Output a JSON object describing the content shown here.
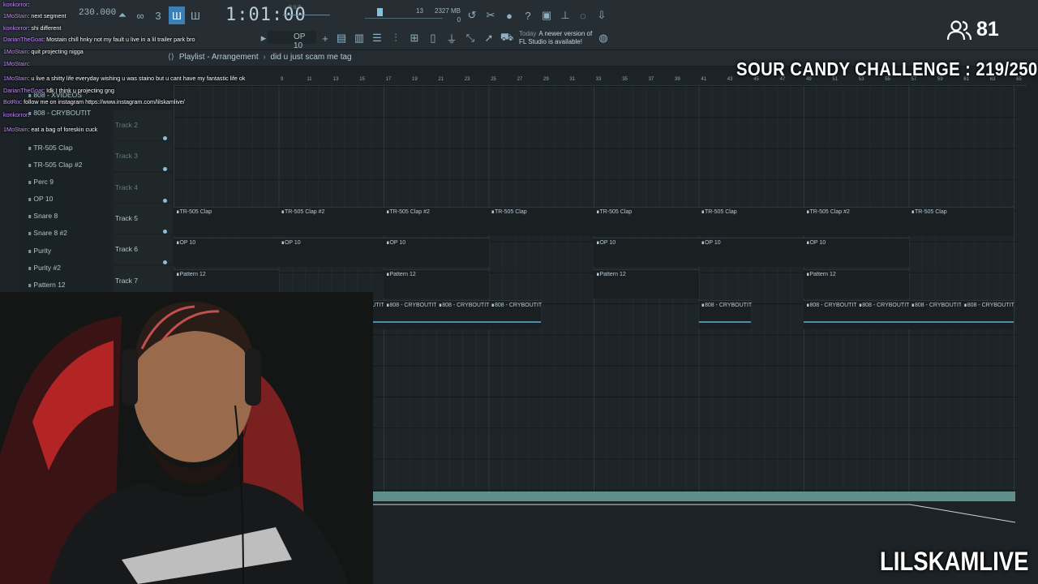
{
  "toolbar": {
    "tempo": "230.000",
    "time": "1:01:00",
    "time_sub": "B:S:T",
    "cpu_count": "13",
    "ram": "2327 MB",
    "ram_sub": "0",
    "pattern": "OP 10",
    "news_today": "Today",
    "news_text_1": "A newer version of",
    "news_text_2": "FL Studio is available!"
  },
  "playlist": {
    "title": "Playlist - Arrangement",
    "crumb": "did u just scam me tag",
    "ruler": [
      "9",
      "11",
      "13",
      "15",
      "17",
      "19",
      "21",
      "23",
      "25",
      "27",
      "29",
      "31",
      "33",
      "35",
      "37",
      "39",
      "41",
      "43",
      "45",
      "47",
      "49",
      "51",
      "53",
      "55",
      "57",
      "59",
      "61",
      "63",
      "65"
    ]
  },
  "browser": {
    "items": [
      "808 - XVIDEOS",
      "808 - CRYBOUTIT",
      "TR-505 Clap",
      "TR-505 Clap #2",
      "Perc 9",
      "OP 10",
      "Snare 8",
      "Snare 8 #2",
      "Purity",
      "Purity #2",
      "Pattern 12"
    ]
  },
  "tracks": [
    {
      "name": "Track 2",
      "dim": true
    },
    {
      "name": "Track 3",
      "dim": true
    },
    {
      "name": "Track 4",
      "dim": true
    },
    {
      "name": "Track 5",
      "dim": false
    },
    {
      "name": "Track 6",
      "dim": false
    },
    {
      "name": "Track 7",
      "dim": false
    },
    {
      "name": "Track 8",
      "dim": false
    }
  ],
  "clips": {
    "t5": [
      "TR-505 Clap",
      "TR-505 Clap #2",
      "TR-505 Clap #2",
      "TR-505 Clap",
      "TR-505 Clap",
      "TR-505 Clap",
      "TR-505 Clap #2",
      "TR-505 Clap"
    ],
    "t6": [
      "OP 10",
      "OP 10",
      "OP 10",
      "OP 10",
      "OP 10",
      "OP 10"
    ],
    "t7": [
      "Pattern 12",
      "Pattern 12",
      "Pattern 12",
      "Pattern 12"
    ],
    "t8": [
      "808 - CRYBOUTIT",
      "808 - CRYBOUTIT",
      "808 - CRYBOUTIT",
      "808 - CRYBOUTIT",
      "808 - CRYBOUTIT",
      "808 - CRYBOUTIT",
      "808 - CRYBOUTIT",
      "808 - CRYBOUTIT",
      "808 - CRYBOUTIT",
      "808 - CRYBOUTIT"
    ]
  },
  "overlay": {
    "viewers": "81",
    "challenge": "SOUR CANDY CHALLENGE : 219/250",
    "brand": "LILSKAMLIVE"
  },
  "chat": [
    {
      "user": "konkorror",
      "msg": ": "
    },
    {
      "user": "1MoStain",
      "msg": ": next segment"
    },
    {
      "user": "konkorror",
      "msg": ": shi different"
    },
    {
      "user": "DarianTheGoat",
      "msg": ": Mostain chill hnky not my fault u live in a lil trailer park bro"
    },
    {
      "user": "1MoStain",
      "msg": ": quit projecting nigga"
    },
    {
      "user": "1MoStain",
      "msg": ": "
    },
    {
      "user": "1MoStain",
      "msg": ": u live a shitty life everyday wishing u was staino but u cant have my fantastic life ok"
    },
    {
      "user": "DarianTheGoat",
      "msg": ": Idk I think u projecting gng"
    },
    {
      "user": "BotRix",
      "msg": ": follow me on instagram https://www.instagram.com/lilskamlive/"
    },
    {
      "user": "konkorror",
      "msg": ": "
    },
    {
      "user": "1MoStain",
      "msg": ": eat a bag of foreskin cuck"
    }
  ],
  "colors": {
    "chat_user": "#c78cff",
    "accent": "#86c0e0",
    "automation": "#5f8f8a"
  }
}
